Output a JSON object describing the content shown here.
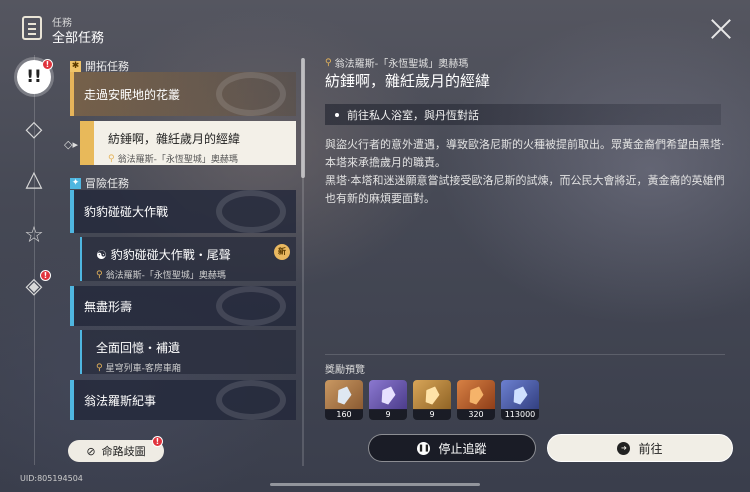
{
  "header": {
    "sub": "任務",
    "title": "全部任務",
    "icon": "quest-book-icon"
  },
  "rail": {
    "items": [
      {
        "name": "rail-all-quests",
        "glyph": "!!",
        "badge": "!",
        "active": true
      },
      {
        "name": "rail-trailblaze",
        "glyph": "◇"
      },
      {
        "name": "rail-companion",
        "glyph": "△"
      },
      {
        "name": "rail-adventure",
        "glyph": "☆"
      },
      {
        "name": "rail-daily",
        "glyph": "◈",
        "badge": "!"
      }
    ]
  },
  "quest_list": {
    "section1": {
      "icon": "✱",
      "label": "開拓任務"
    },
    "section2": {
      "icon": "✦",
      "label": "冒險任務"
    },
    "quests": [
      {
        "title": "走過安眠地的花叢"
      },
      {
        "title": "豹豹碰碰大作戰"
      },
      {
        "title": "無盡形壽"
      },
      {
        "title": "翁法羅斯紀事"
      }
    ],
    "subquests": [
      {
        "title": "紡錘啊，雜紝歲月的經緯",
        "location": "翁法羅斯-「永恆聖城」奧赫瑪",
        "selected": true
      },
      {
        "title": "豹豹碰碰大作戰・尾聲",
        "location": "翁法羅斯-「永恆聖城」奧赫瑪",
        "new_badge": "新"
      },
      {
        "title": "全面回憶・補遺",
        "location": "星穹列車-客房車廂"
      }
    ]
  },
  "detail": {
    "location": "翁法羅斯-「永恆聖城」奧赫瑪",
    "title": "紡錘啊，雜紝歲月的經緯",
    "objective": "前往私人浴室，與丹恆對話",
    "description_1": "與盜火行者的意外遭遇，導致歐洛尼斯的火種被提前取出。眾黃金裔們希望由黑塔·本塔來承擔歲月的職責。",
    "description_2": "黑塔·本塔和迷迷願意嘗試接受歐洛尼斯的試煉，而公民大會將近，黃金裔的英雄們也有新的麻煩要面對。",
    "rewards_label": "獎勵預覽",
    "rewards": [
      {
        "name": "stellar-jade",
        "count": "160",
        "color": "#b9814f"
      },
      {
        "name": "exp-material",
        "count": "9",
        "color": "#6f5fb5"
      },
      {
        "name": "gold-material",
        "count": "9",
        "color": "#b98a4a"
      },
      {
        "name": "relic-item",
        "count": "320",
        "color": "#c26a32"
      },
      {
        "name": "credit-item",
        "count": "113000",
        "color": "#4e5fa8"
      }
    ]
  },
  "buttons": {
    "stop": "停止追蹤",
    "go": "前往",
    "path": "命路歧圖",
    "path_badge": "!"
  },
  "uid": "UID:805194504"
}
